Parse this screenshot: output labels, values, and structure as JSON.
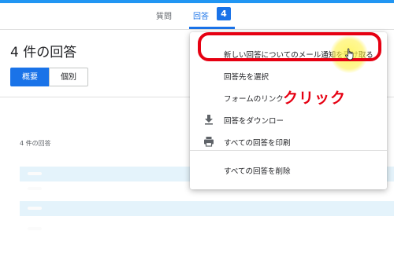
{
  "colors": {
    "accent": "#1a73e8",
    "annotation": "#e60012",
    "highlight": "#fff04c"
  },
  "tabs": {
    "questions_label": "質問",
    "responses_label": "回答",
    "responses_count": "4"
  },
  "page": {
    "title": "4 件の回答",
    "view_toggle": {
      "summary_label": "概要",
      "individual_label": "個別",
      "selected": "summary"
    },
    "responses_caption": "4 件の回答"
  },
  "menu": {
    "items": [
      {
        "label": "新しい回答についてのメール通知を受け取る",
        "icon": ""
      },
      {
        "label": "回答先を選択",
        "icon": ""
      },
      {
        "label": "フォームのリンク",
        "icon": ""
      },
      {
        "label": "回答をダウンロー",
        "icon": "download-icon"
      },
      {
        "label": "すべての回答を印刷",
        "icon": "printer-icon"
      },
      {
        "label": "すべての回答を削除",
        "icon": ""
      }
    ]
  },
  "annotation": {
    "text": "クリック"
  }
}
